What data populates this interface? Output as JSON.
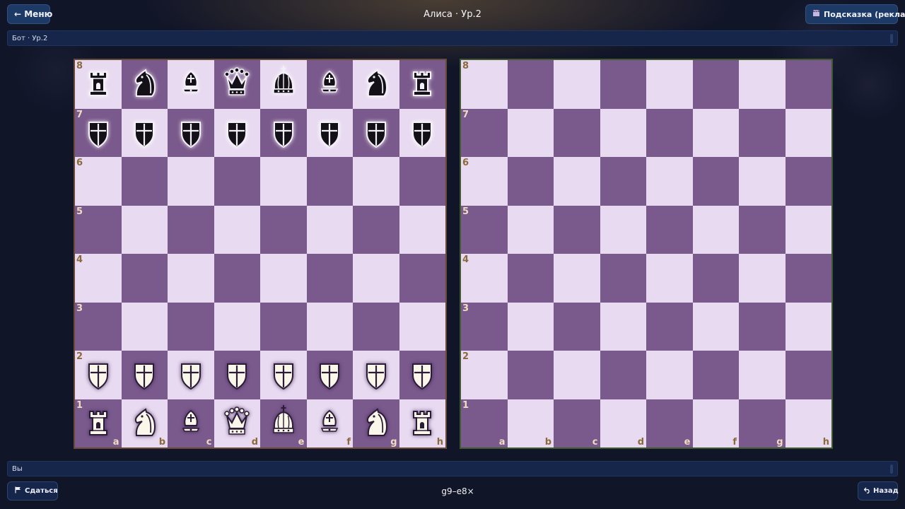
{
  "header": {
    "menu_label": "← Меню",
    "title": "Алиса · Ур.2",
    "hint_label": "Подсказка (реклама)",
    "hint_icon": "clapperboard-icon"
  },
  "bot_bar": {
    "label": "Бот · Ур.2"
  },
  "you_bar": {
    "label": "Вы"
  },
  "footer": {
    "resign_label": "Сдаться",
    "resign_icon": "flag-icon",
    "back_label": "Назад",
    "back_icon": "undo-icon",
    "move_text": "g9–e8×"
  },
  "colors": {
    "light_square": "#e8daf0",
    "dark_square": "#7a5a8c",
    "button_bg": "#1d3a66",
    "background": "#111528"
  },
  "boards": {
    "files": [
      "a",
      "b",
      "c",
      "d",
      "e",
      "f",
      "g",
      "h"
    ],
    "ranks": [
      "8",
      "7",
      "6",
      "5",
      "4",
      "3",
      "2",
      "1"
    ],
    "left": {
      "position": [
        [
          "bR",
          "bN",
          "bB",
          "bQ",
          "bK",
          "bB",
          "bN",
          "bR"
        ],
        [
          "bP",
          "bP",
          "bP",
          "bP",
          "bP",
          "bP",
          "bP",
          "bP"
        ],
        [
          "",
          "",
          "",
          "",
          "",
          "",
          "",
          ""
        ],
        [
          "",
          "",
          "",
          "",
          "",
          "",
          "",
          ""
        ],
        [
          "",
          "",
          "",
          "",
          "",
          "",
          "",
          ""
        ],
        [
          "",
          "",
          "",
          "",
          "",
          "",
          "",
          ""
        ],
        [
          "wP",
          "wP",
          "wP",
          "wP",
          "wP",
          "wP",
          "wP",
          "wP"
        ],
        [
          "wR",
          "wN",
          "wB",
          "wQ",
          "wK",
          "wB",
          "wN",
          "wR"
        ]
      ]
    },
    "right": {
      "position": [
        [
          "",
          "",
          "",
          "",
          "",
          "",
          "",
          ""
        ],
        [
          "",
          "",
          "",
          "",
          "",
          "",
          "",
          ""
        ],
        [
          "",
          "",
          "",
          "",
          "",
          "",
          "",
          ""
        ],
        [
          "",
          "",
          "",
          "",
          "",
          "",
          "",
          ""
        ],
        [
          "",
          "",
          "",
          "",
          "",
          "",
          "",
          ""
        ],
        [
          "",
          "",
          "",
          "",
          "",
          "",
          "",
          ""
        ],
        [
          "",
          "",
          "",
          "",
          "",
          "",
          "",
          ""
        ],
        [
          "",
          "",
          "",
          "",
          "",
          "",
          "",
          ""
        ]
      ]
    },
    "piece_names": {
      "R": "rook",
      "N": "knight",
      "B": "bishop",
      "Q": "queen",
      "K": "king",
      "P": "pawn"
    }
  }
}
